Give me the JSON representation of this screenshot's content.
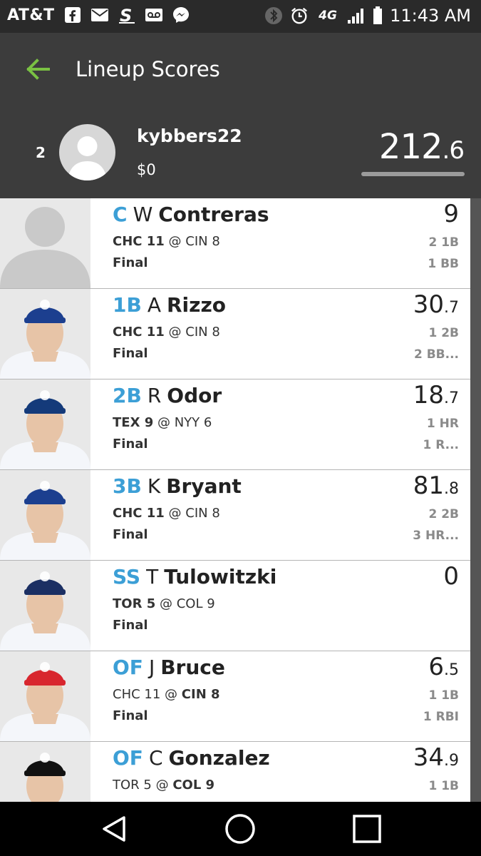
{
  "status_bar": {
    "carrier": "AT&T",
    "time": "11:43 AM",
    "network": "4G",
    "left_icons": [
      "facebook-icon",
      "mail-icon",
      "s-app-icon",
      "voicemail-icon",
      "messenger-icon"
    ],
    "right_icons": [
      "bluetooth-icon",
      "alarm-icon",
      "network-4g-icon",
      "signal-icon",
      "battery-icon"
    ]
  },
  "app_bar": {
    "title": "Lineup Scores",
    "back_icon": "back-arrow-icon",
    "accent": "#7ac143"
  },
  "user": {
    "rank": "2",
    "username": "kybbers22",
    "winnings": "$0",
    "total_whole": "212",
    "total_dec": ".6"
  },
  "colors": {
    "position": "#3c9fd6",
    "header_bg": "#3c3c3c",
    "status_bg": "#2a2a2a"
  },
  "players": [
    {
      "pos": "C",
      "first": "W",
      "last": "Contreras",
      "away": "CHC 11",
      "at": "@",
      "home": "CIN 8",
      "bold": "away",
      "status": "Final",
      "pts_whole": "9",
      "pts_dec": "",
      "stat1": "2 1B",
      "stat2": "1 BB",
      "cap": "none"
    },
    {
      "pos": "1B",
      "first": "A",
      "last": "Rizzo",
      "away": "CHC 11",
      "at": "@",
      "home": "CIN 8",
      "bold": "away",
      "status": "Final",
      "pts_whole": "30",
      "pts_dec": ".7",
      "stat1": "1 2B",
      "stat2": "2 BB...",
      "cap": "#1c3f8f"
    },
    {
      "pos": "2B",
      "first": "R",
      "last": "Odor",
      "away": "TEX 9",
      "at": "@",
      "home": "NYY 6",
      "bold": "away",
      "status": "Final",
      "pts_whole": "18",
      "pts_dec": ".7",
      "stat1": "1 HR",
      "stat2": "1 R...",
      "cap": "#143a7a"
    },
    {
      "pos": "3B",
      "first": "K",
      "last": "Bryant",
      "away": "CHC 11",
      "at": "@",
      "home": "CIN 8",
      "bold": "away",
      "status": "Final",
      "pts_whole": "81",
      "pts_dec": ".8",
      "stat1": "2 2B",
      "stat2": "3 HR...",
      "cap": "#1c3f8f"
    },
    {
      "pos": "SS",
      "first": "T",
      "last": "Tulowitzki",
      "away": "TOR 5",
      "at": "@",
      "home": "COL 9",
      "bold": "away",
      "status": "Final",
      "pts_whole": "0",
      "pts_dec": "",
      "stat1": "",
      "stat2": "",
      "cap": "#1b2f63"
    },
    {
      "pos": "OF",
      "first": "J",
      "last": "Bruce",
      "away": "CHC 11",
      "at": "@",
      "home": "CIN 8",
      "bold": "home",
      "status": "Final",
      "pts_whole": "6",
      "pts_dec": ".5",
      "stat1": "1 1B",
      "stat2": "1 RBI",
      "cap": "#d8262e"
    },
    {
      "pos": "OF",
      "first": "C",
      "last": "Gonzalez",
      "away": "TOR 5",
      "at": "@",
      "home": "COL 9",
      "bold": "home",
      "status": "",
      "pts_whole": "34",
      "pts_dec": ".9",
      "stat1": "1 1B",
      "stat2": "",
      "cap": "#111111"
    }
  ],
  "nav": {
    "back_icon": "triangle-back-icon",
    "home_icon": "circle-home-icon",
    "recents_icon": "square-recents-icon"
  }
}
